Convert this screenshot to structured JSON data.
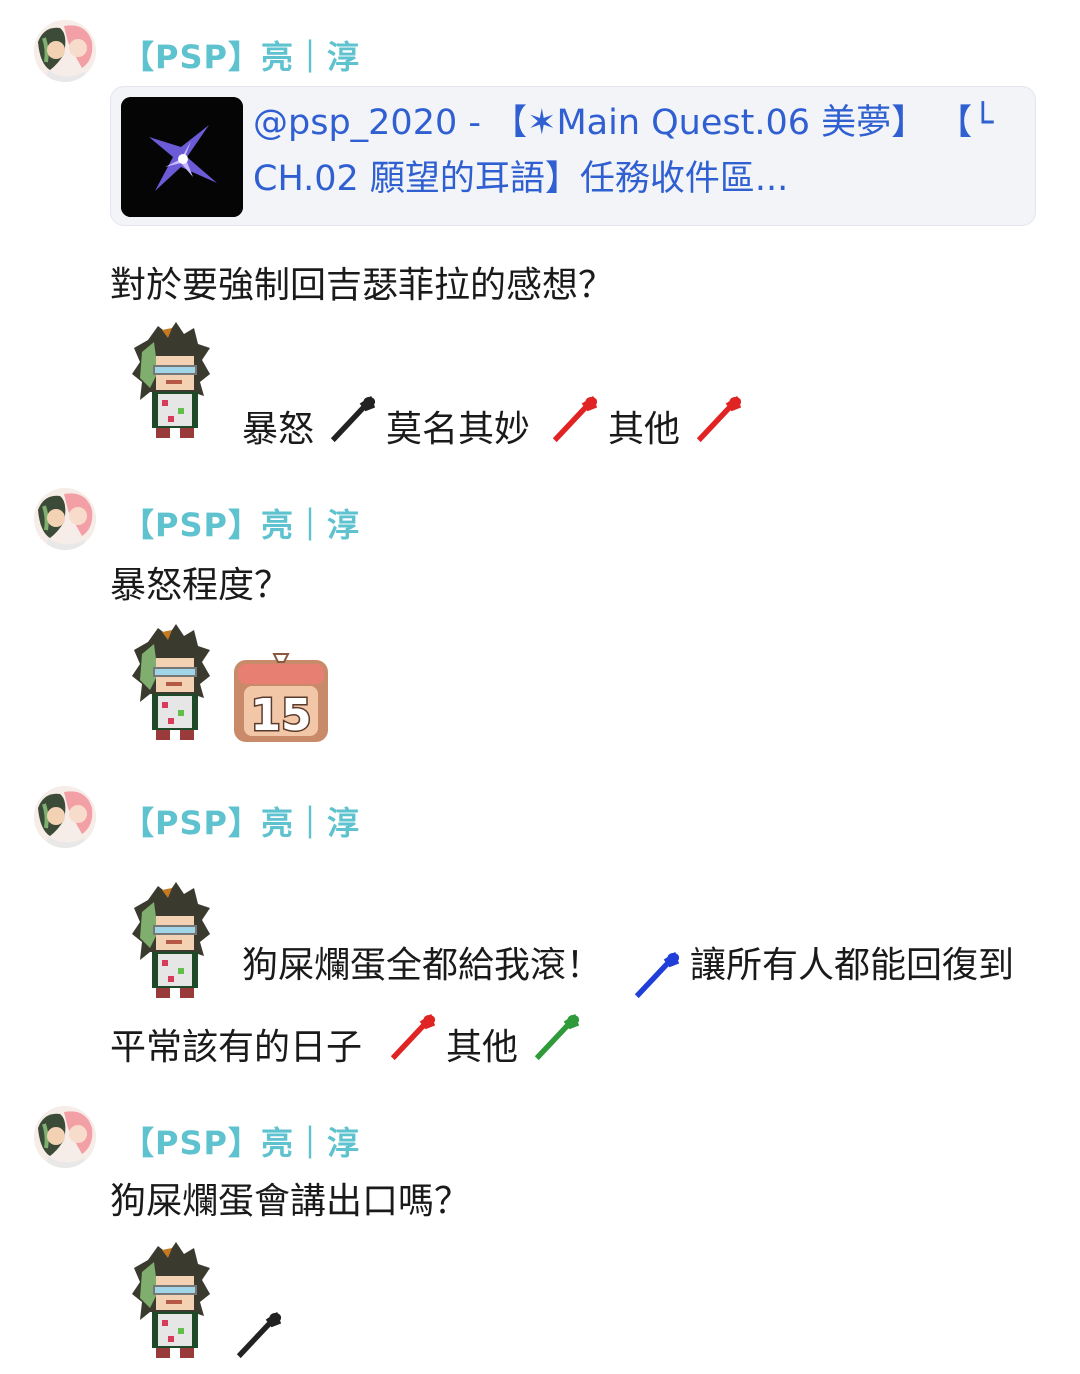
{
  "messages": [
    {
      "sender": "【PSP】亮｜淳",
      "quote": {
        "text": "@psp_2020 - 【✶Main Quest.06 美夢】 【└ CH.02 願望的耳語】任務收件區..."
      },
      "text": "對於要強制回吉瑟菲拉的感想？",
      "sticker_line": {
        "options": [
          "暴怒",
          "莫名其妙",
          "其他"
        ]
      }
    },
    {
      "sender": "【PSP】亮｜淳",
      "text": "暴怒程度？",
      "calendar_number": "15"
    },
    {
      "sender": "【PSP】亮｜淳",
      "sticker_line": {
        "options": [
          "狗屎爛蛋全都給我滾！",
          "讓所有人都能回復到"
        ]
      },
      "continuation": {
        "options": [
          "平常該有的日子",
          "其他"
        ]
      }
    },
    {
      "sender": "【PSP】亮｜淳",
      "text": "狗屎爛蛋會講出口嗎？"
    }
  ],
  "colors": {
    "sender_name": "#5ec2cf",
    "quote_link": "#2f5fd1",
    "horn_black": "#222222",
    "horn_red": "#e02424",
    "horn_blue": "#1f3fd8",
    "horn_green": "#2f9a3a"
  },
  "icons": [
    "user-avatar-icon",
    "star-thumbnail-icon",
    "pixel-character-sticker",
    "horn-icon",
    "calendar-icon"
  ]
}
